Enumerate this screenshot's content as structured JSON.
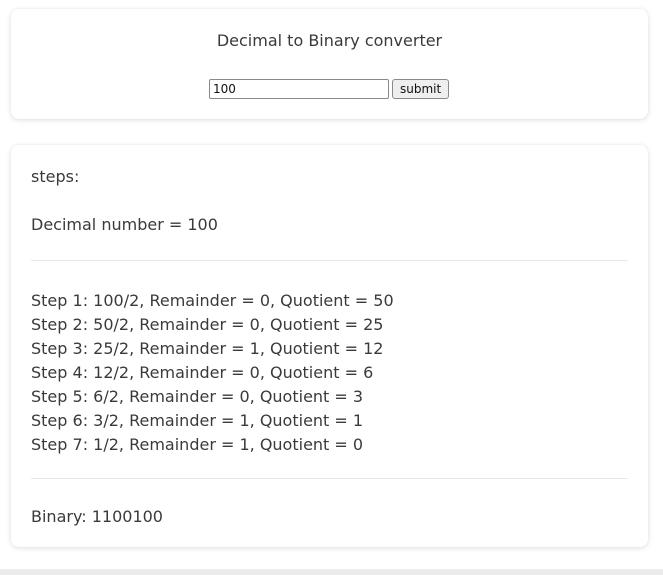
{
  "header": {
    "title": "Decimal to Binary converter"
  },
  "form": {
    "input_value": "100",
    "submit_label": "submit"
  },
  "steps": {
    "label": "steps:",
    "decimal_line": "Decimal number = 100",
    "items": [
      "Step 1: 100/2, Remainder = 0, Quotient = 50",
      "Step 2: 50/2, Remainder = 0, Quotient = 25",
      "Step 3: 25/2, Remainder = 1, Quotient = 12",
      "Step 4: 12/2, Remainder = 0, Quotient = 6",
      "Step 5: 6/2, Remainder = 0, Quotient = 3",
      "Step 6: 3/2, Remainder = 1, Quotient = 1",
      "Step 7: 1/2, Remainder = 1, Quotient = 0"
    ],
    "result": "Binary: 1100100"
  }
}
